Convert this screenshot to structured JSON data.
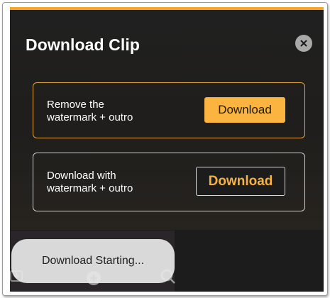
{
  "colors": {
    "accent": "#f5a623",
    "button_primary": "#fab43f",
    "panel_bg": "#1c1c1c"
  },
  "dialog": {
    "title": "Download Clip",
    "close_icon": "close-icon",
    "options": [
      {
        "label": "Remove the\nwatermark + outro",
        "button_label": "Download"
      },
      {
        "label": "Download with\nwatermark + outro",
        "button_label": "Download"
      }
    ]
  },
  "toast": {
    "message": "Download Starting..."
  },
  "background_icons": [
    "download-icon",
    "plus-circle-icon",
    "search-icon"
  ]
}
